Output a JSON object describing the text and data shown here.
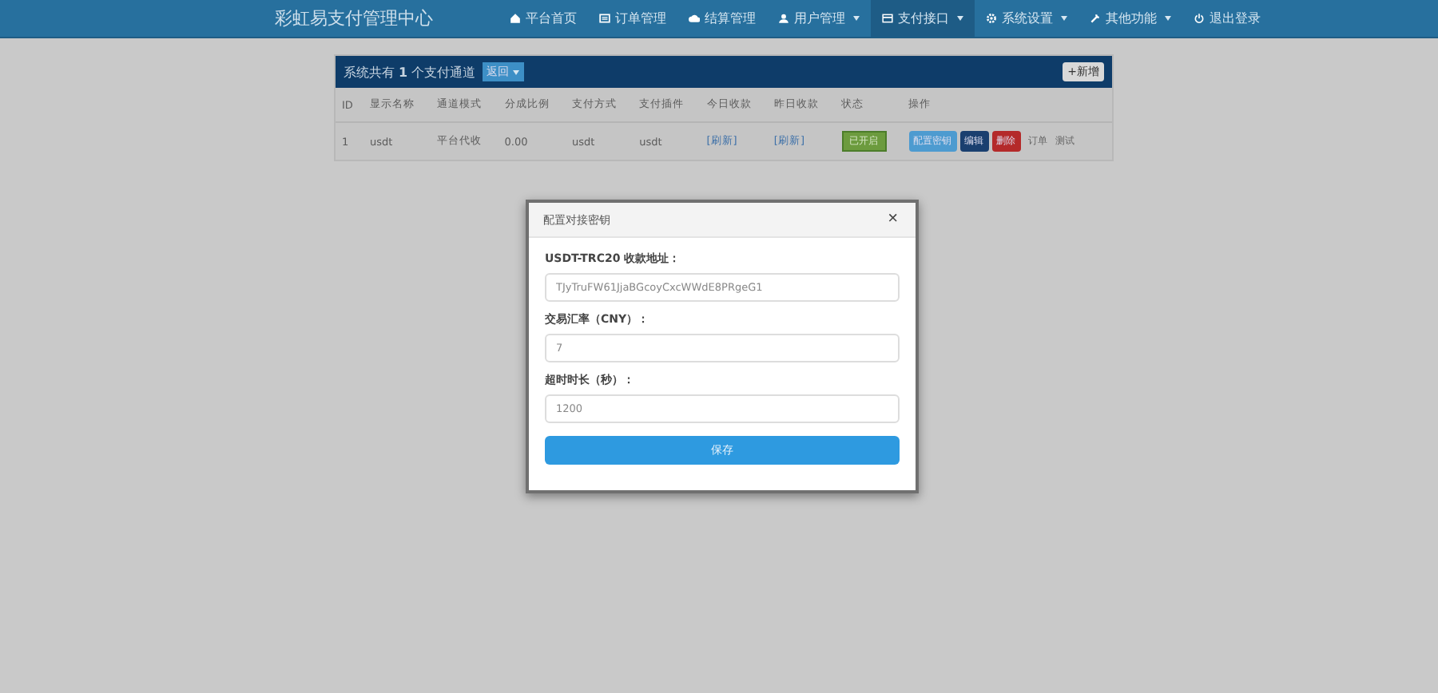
{
  "navbar": {
    "brand": "彩虹易支付管理中心",
    "items": [
      {
        "label": "平台首页",
        "kind": "home",
        "dropdown": false,
        "selected": false
      },
      {
        "label": "订单管理",
        "kind": "list",
        "dropdown": false,
        "selected": false
      },
      {
        "label": "结算管理",
        "kind": "cloud",
        "dropdown": false,
        "selected": false
      },
      {
        "label": "用户管理",
        "kind": "user",
        "dropdown": true,
        "selected": false
      },
      {
        "label": "支付接口",
        "kind": "card",
        "dropdown": true,
        "selected": true
      },
      {
        "label": "系统设置",
        "kind": "gear",
        "dropdown": true,
        "selected": false
      },
      {
        "label": "其他功能",
        "kind": "tools",
        "dropdown": true,
        "selected": false
      },
      {
        "label": "退出登录",
        "kind": "power",
        "dropdown": false,
        "selected": false
      }
    ]
  },
  "panel": {
    "title": "系统共有 **1** 个支付通道",
    "filter_button": "返回",
    "add_button": "+新增",
    "table": {
      "columns": [
        "ID",
        "显示名称",
        "通道模式",
        "分成比例",
        "支付方式",
        "支付插件",
        "今日收款",
        "昨日收款",
        "状态",
        "操作"
      ],
      "rows": [
        {
          "cells": [
            "1",
            "usdt",
            "平台代收",
            "0.00",
            "usdt",
            "usdt"
          ],
          "today": "[刷新]",
          "yesterday": "[刷新]",
          "status": "已开启",
          "enabled": true,
          "actions": [
            {
              "label": "配置密钥",
              "kind": "info"
            },
            {
              "label": "编辑",
              "kind": "primary"
            },
            {
              "label": "删除",
              "kind": "danger"
            },
            {
              "label": "订单",
              "kind": "link"
            },
            {
              "label": "测试",
              "kind": "link"
            }
          ]
        }
      ]
    }
  },
  "modal": {
    "title": "配置对接密钥",
    "close": "×",
    "fields": [
      {
        "label": "USDT-TRC20 收款地址：",
        "value": "TJyTruFW61JjaBGcoyCxcWWdE8PRgeG1"
      },
      {
        "label": "交易汇率（CNY）：",
        "value": "7"
      },
      {
        "label": "超时时长（秒）：",
        "value": "1200"
      }
    ],
    "submit": "保存"
  }
}
